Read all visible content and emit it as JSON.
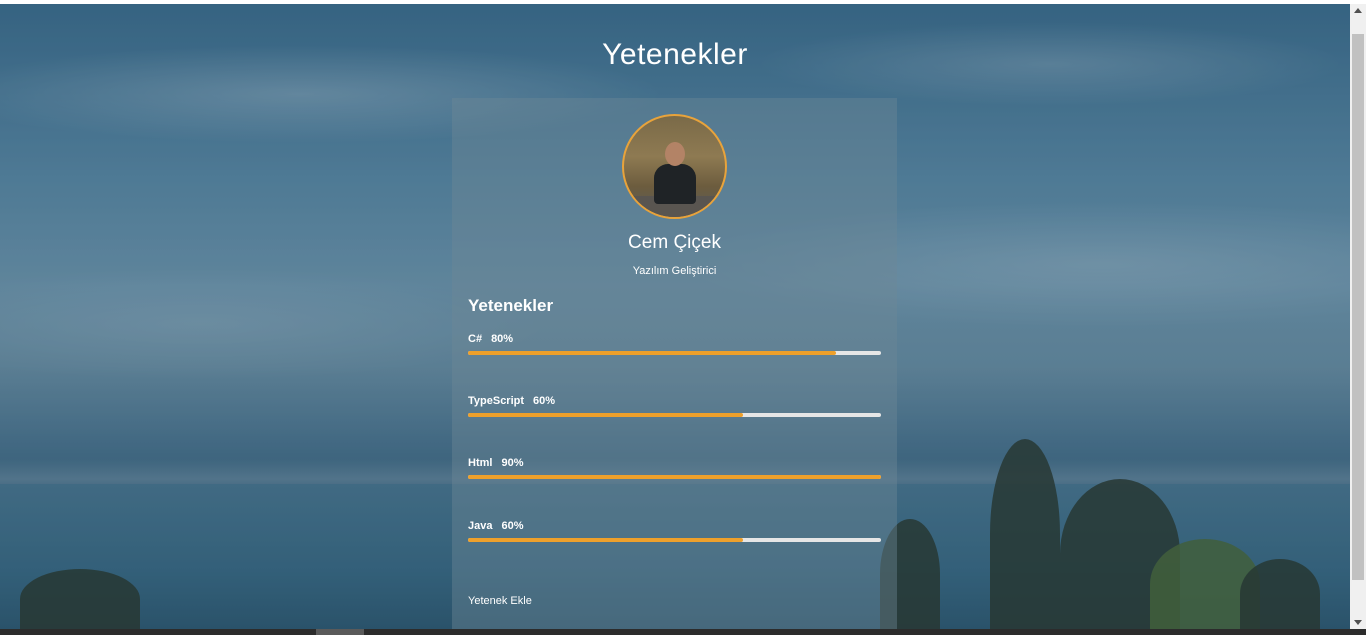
{
  "page": {
    "title": "Yetenekler"
  },
  "profile": {
    "name": "Cem Çiçek",
    "role": "Yazılım Geliştirici",
    "avatar_icon": "profile-photo",
    "avatar_border_color": "#e8a33b"
  },
  "skills": {
    "heading": "Yetenekler",
    "items": [
      {
        "name": "C#",
        "percent_label": "80%",
        "level": 0.89
      },
      {
        "name": "TypeScript",
        "percent_label": "60%",
        "level": 0.665
      },
      {
        "name": "Html",
        "percent_label": "90%",
        "level": 1.0
      },
      {
        "name": "Java",
        "percent_label": "60%",
        "level": 0.665
      }
    ],
    "bar_color": "#eea02b",
    "track_color": "#e6e6e6",
    "add_label": "Yetenek Ekle"
  }
}
